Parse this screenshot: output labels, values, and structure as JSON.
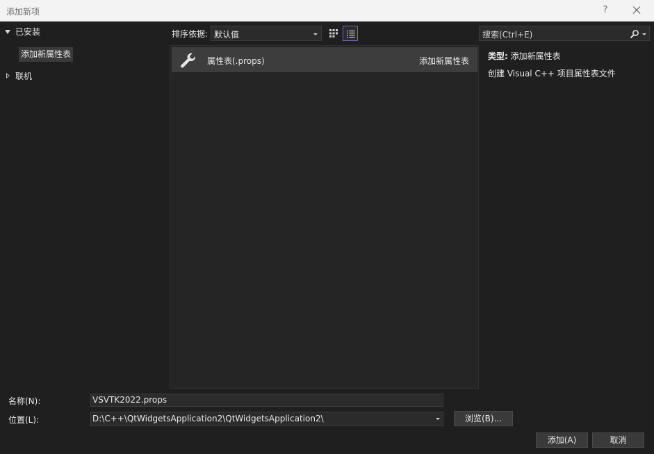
{
  "window": {
    "title": "添加新项",
    "help_label": "?"
  },
  "tree": {
    "installed_label": "已安装",
    "selected_item": "添加新属性表",
    "online_label": "联机"
  },
  "toolbar": {
    "sort_label": "排序依据:",
    "sort_value": "默认值"
  },
  "search": {
    "placeholder": "搜索(Ctrl+E)"
  },
  "templates": [
    {
      "name": "属性表(.props)",
      "category": "添加新属性表",
      "icon": "wrench-icon"
    }
  ],
  "details": {
    "type_label": "类型:",
    "type_value": "添加新属性表",
    "description": "创建 Visual C++ 项目属性表文件"
  },
  "form": {
    "name_label": "名称(N):",
    "name_value": "VSVTK2022.props",
    "location_label": "位置(L):",
    "location_value": "D:\\C++\\QtWidgetsApplication2\\QtWidgetsApplication2\\",
    "browse_label": "浏览(B)...",
    "add_label": "添加(A)",
    "cancel_label": "取消"
  },
  "colors": {
    "background": "#1f1f1f",
    "titlebar": "#f3f3f3",
    "selected_row": "#3d3d3d",
    "accent": "#6d5fd6"
  }
}
